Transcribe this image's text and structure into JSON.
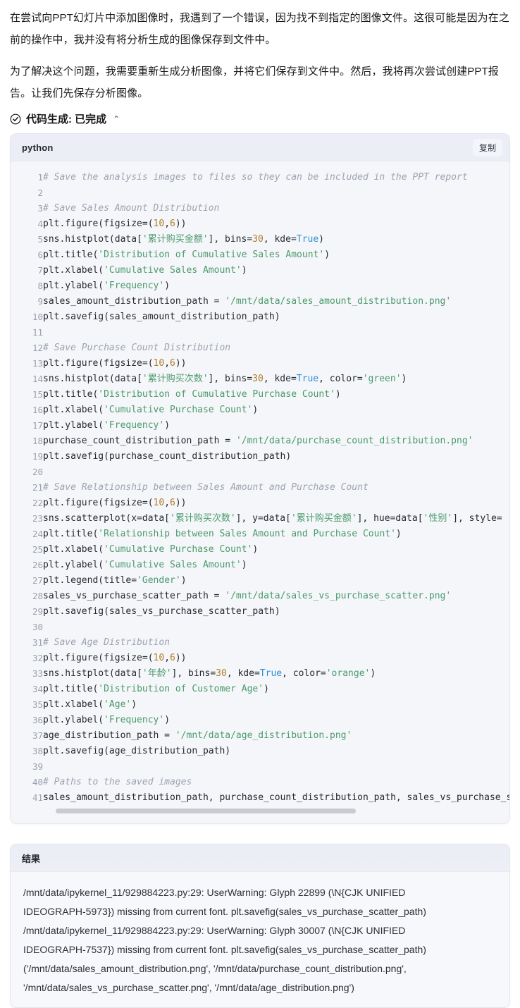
{
  "message": {
    "paragraphs": [
      "在尝试向PPT幻灯片中添加图像时，我遇到了一个错误，因为找不到指定的图像文件。这很可能是因为在之前的操作中，我并没有将分析生成的图像保存到文件中。",
      "为了解决这个问题，我需要重新生成分析图像，并将它们保存到文件中。然后，我将再次尝试创建PPT报告。让我们先保存分析图像。"
    ]
  },
  "tool_header": {
    "icon": "check-circle-icon",
    "label": "代码生成: 已完成",
    "chevron": "⌃"
  },
  "code_block": {
    "language": "python",
    "copy_label": "复制",
    "scroll": {
      "thumb_percent": 67
    },
    "lines": [
      {
        "n": "1",
        "tokens": [
          {
            "t": "com",
            "v": "# Save the analysis images to files so they can be included in the PPT report"
          }
        ]
      },
      {
        "n": "2",
        "tokens": []
      },
      {
        "n": "3",
        "tokens": [
          {
            "t": "com",
            "v": "# Save Sales Amount Distribution"
          }
        ]
      },
      {
        "n": "4",
        "tokens": [
          {
            "t": "plain",
            "v": "plt.figure(figsize=("
          },
          {
            "t": "num",
            "v": "10"
          },
          {
            "t": "plain",
            "v": ","
          },
          {
            "t": "num",
            "v": "6"
          },
          {
            "t": "plain",
            "v": "))"
          }
        ]
      },
      {
        "n": "5",
        "tokens": [
          {
            "t": "plain",
            "v": "sns.histplot(data["
          },
          {
            "t": "str",
            "v": "'累计购买金额'"
          },
          {
            "t": "plain",
            "v": "], bins="
          },
          {
            "t": "num",
            "v": "30"
          },
          {
            "t": "plain",
            "v": ", kde="
          },
          {
            "t": "kw",
            "v": "True"
          },
          {
            "t": "plain",
            "v": ")"
          }
        ]
      },
      {
        "n": "6",
        "tokens": [
          {
            "t": "plain",
            "v": "plt.title("
          },
          {
            "t": "str",
            "v": "'Distribution of Cumulative Sales Amount'"
          },
          {
            "t": "plain",
            "v": ")"
          }
        ]
      },
      {
        "n": "7",
        "tokens": [
          {
            "t": "plain",
            "v": "plt.xlabel("
          },
          {
            "t": "str",
            "v": "'Cumulative Sales Amount'"
          },
          {
            "t": "plain",
            "v": ")"
          }
        ]
      },
      {
        "n": "8",
        "tokens": [
          {
            "t": "plain",
            "v": "plt.ylabel("
          },
          {
            "t": "str",
            "v": "'Frequency'"
          },
          {
            "t": "plain",
            "v": ")"
          }
        ]
      },
      {
        "n": "9",
        "tokens": [
          {
            "t": "plain",
            "v": "sales_amount_distribution_path = "
          },
          {
            "t": "str",
            "v": "'/mnt/data/sales_amount_distribution.png'"
          }
        ]
      },
      {
        "n": "10",
        "tokens": [
          {
            "t": "plain",
            "v": "plt.savefig(sales_amount_distribution_path)"
          }
        ]
      },
      {
        "n": "11",
        "tokens": []
      },
      {
        "n": "12",
        "tokens": [
          {
            "t": "com",
            "v": "# Save Purchase Count Distribution"
          }
        ]
      },
      {
        "n": "13",
        "tokens": [
          {
            "t": "plain",
            "v": "plt.figure(figsize=("
          },
          {
            "t": "num",
            "v": "10"
          },
          {
            "t": "plain",
            "v": ","
          },
          {
            "t": "num",
            "v": "6"
          },
          {
            "t": "plain",
            "v": "))"
          }
        ]
      },
      {
        "n": "14",
        "tokens": [
          {
            "t": "plain",
            "v": "sns.histplot(data["
          },
          {
            "t": "str",
            "v": "'累计购买次数'"
          },
          {
            "t": "plain",
            "v": "], bins="
          },
          {
            "t": "num",
            "v": "30"
          },
          {
            "t": "plain",
            "v": ", kde="
          },
          {
            "t": "kw",
            "v": "True"
          },
          {
            "t": "plain",
            "v": ", color="
          },
          {
            "t": "str",
            "v": "'green'"
          },
          {
            "t": "plain",
            "v": ")"
          }
        ]
      },
      {
        "n": "15",
        "tokens": [
          {
            "t": "plain",
            "v": "plt.title("
          },
          {
            "t": "str",
            "v": "'Distribution of Cumulative Purchase Count'"
          },
          {
            "t": "plain",
            "v": ")"
          }
        ]
      },
      {
        "n": "16",
        "tokens": [
          {
            "t": "plain",
            "v": "plt.xlabel("
          },
          {
            "t": "str",
            "v": "'Cumulative Purchase Count'"
          },
          {
            "t": "plain",
            "v": ")"
          }
        ]
      },
      {
        "n": "17",
        "tokens": [
          {
            "t": "plain",
            "v": "plt.ylabel("
          },
          {
            "t": "str",
            "v": "'Frequency'"
          },
          {
            "t": "plain",
            "v": ")"
          }
        ]
      },
      {
        "n": "18",
        "tokens": [
          {
            "t": "plain",
            "v": "purchase_count_distribution_path = "
          },
          {
            "t": "str",
            "v": "'/mnt/data/purchase_count_distribution.png'"
          }
        ]
      },
      {
        "n": "19",
        "tokens": [
          {
            "t": "plain",
            "v": "plt.savefig(purchase_count_distribution_path)"
          }
        ]
      },
      {
        "n": "20",
        "tokens": []
      },
      {
        "n": "21",
        "tokens": [
          {
            "t": "com",
            "v": "# Save Relationship between Sales Amount and Purchase Count"
          }
        ]
      },
      {
        "n": "22",
        "tokens": [
          {
            "t": "plain",
            "v": "plt.figure(figsize=("
          },
          {
            "t": "num",
            "v": "10"
          },
          {
            "t": "plain",
            "v": ","
          },
          {
            "t": "num",
            "v": "6"
          },
          {
            "t": "plain",
            "v": "))"
          }
        ]
      },
      {
        "n": "23",
        "tokens": [
          {
            "t": "plain",
            "v": "sns.scatterplot(x=data["
          },
          {
            "t": "str",
            "v": "'累计购买次数'"
          },
          {
            "t": "plain",
            "v": "], y=data["
          },
          {
            "t": "str",
            "v": "'累计购买金额'"
          },
          {
            "t": "plain",
            "v": "], hue=data["
          },
          {
            "t": "str",
            "v": "'性别'"
          },
          {
            "t": "plain",
            "v": "], style="
          }
        ]
      },
      {
        "n": "24",
        "tokens": [
          {
            "t": "plain",
            "v": "plt.title("
          },
          {
            "t": "str",
            "v": "'Relationship between Sales Amount and Purchase Count'"
          },
          {
            "t": "plain",
            "v": ")"
          }
        ]
      },
      {
        "n": "25",
        "tokens": [
          {
            "t": "plain",
            "v": "plt.xlabel("
          },
          {
            "t": "str",
            "v": "'Cumulative Purchase Count'"
          },
          {
            "t": "plain",
            "v": ")"
          }
        ]
      },
      {
        "n": "26",
        "tokens": [
          {
            "t": "plain",
            "v": "plt.ylabel("
          },
          {
            "t": "str",
            "v": "'Cumulative Sales Amount'"
          },
          {
            "t": "plain",
            "v": ")"
          }
        ]
      },
      {
        "n": "27",
        "tokens": [
          {
            "t": "plain",
            "v": "plt.legend(title="
          },
          {
            "t": "str",
            "v": "'Gender'"
          },
          {
            "t": "plain",
            "v": ")"
          }
        ]
      },
      {
        "n": "28",
        "tokens": [
          {
            "t": "plain",
            "v": "sales_vs_purchase_scatter_path = "
          },
          {
            "t": "str",
            "v": "'/mnt/data/sales_vs_purchase_scatter.png'"
          }
        ]
      },
      {
        "n": "29",
        "tokens": [
          {
            "t": "plain",
            "v": "plt.savefig(sales_vs_purchase_scatter_path)"
          }
        ]
      },
      {
        "n": "30",
        "tokens": []
      },
      {
        "n": "31",
        "tokens": [
          {
            "t": "com",
            "v": "# Save Age Distribution"
          }
        ]
      },
      {
        "n": "32",
        "tokens": [
          {
            "t": "plain",
            "v": "plt.figure(figsize=("
          },
          {
            "t": "num",
            "v": "10"
          },
          {
            "t": "plain",
            "v": ","
          },
          {
            "t": "num",
            "v": "6"
          },
          {
            "t": "plain",
            "v": "))"
          }
        ]
      },
      {
        "n": "33",
        "tokens": [
          {
            "t": "plain",
            "v": "sns.histplot(data["
          },
          {
            "t": "str",
            "v": "'年龄'"
          },
          {
            "t": "plain",
            "v": "], bins="
          },
          {
            "t": "num",
            "v": "30"
          },
          {
            "t": "plain",
            "v": ", kde="
          },
          {
            "t": "kw",
            "v": "True"
          },
          {
            "t": "plain",
            "v": ", color="
          },
          {
            "t": "str",
            "v": "'orange'"
          },
          {
            "t": "plain",
            "v": ")"
          }
        ]
      },
      {
        "n": "34",
        "tokens": [
          {
            "t": "plain",
            "v": "plt.title("
          },
          {
            "t": "str",
            "v": "'Distribution of Customer Age'"
          },
          {
            "t": "plain",
            "v": ")"
          }
        ]
      },
      {
        "n": "35",
        "tokens": [
          {
            "t": "plain",
            "v": "plt.xlabel("
          },
          {
            "t": "str",
            "v": "'Age'"
          },
          {
            "t": "plain",
            "v": ")"
          }
        ]
      },
      {
        "n": "36",
        "tokens": [
          {
            "t": "plain",
            "v": "plt.ylabel("
          },
          {
            "t": "str",
            "v": "'Frequency'"
          },
          {
            "t": "plain",
            "v": ")"
          }
        ]
      },
      {
        "n": "37",
        "tokens": [
          {
            "t": "plain",
            "v": "age_distribution_path = "
          },
          {
            "t": "str",
            "v": "'/mnt/data/age_distribution.png'"
          }
        ]
      },
      {
        "n": "38",
        "tokens": [
          {
            "t": "plain",
            "v": "plt.savefig(age_distribution_path)"
          }
        ]
      },
      {
        "n": "39",
        "tokens": []
      },
      {
        "n": "40",
        "tokens": [
          {
            "t": "com",
            "v": "# Paths to the saved images"
          }
        ]
      },
      {
        "n": "41",
        "tokens": [
          {
            "t": "plain",
            "v": "sales_amount_distribution_path, purchase_count_distribution_path, sales_vs_purchase_s"
          }
        ]
      }
    ]
  },
  "result_block": {
    "title": "结果",
    "lines": [
      "/mnt/data/ipykernel_11/929884223.py:29: UserWarning: Glyph 22899 (\\N{CJK UNIFIED",
      "IDEOGRAPH-5973}) missing from current font. plt.savefig(sales_vs_purchase_scatter_path)",
      "/mnt/data/ipykernel_11/929884223.py:29: UserWarning: Glyph 30007 (\\N{CJK UNIFIED",
      "IDEOGRAPH-7537}) missing from current font. plt.savefig(sales_vs_purchase_scatter_path)",
      "('/mnt/data/sales_amount_distribution.png', '/mnt/data/purchase_count_distribution.png',",
      "'/mnt/data/sales_vs_purchase_scatter.png', '/mnt/data/age_distribution.png')"
    ]
  },
  "colors": {
    "code_bg": "#f5f6fa",
    "header_bg": "#eceef6",
    "string": "#4a9a6a",
    "comment": "#9ca3af",
    "number": "#b07d2b",
    "keyword": "#2c8fd6",
    "border": "#e6e8ef"
  }
}
